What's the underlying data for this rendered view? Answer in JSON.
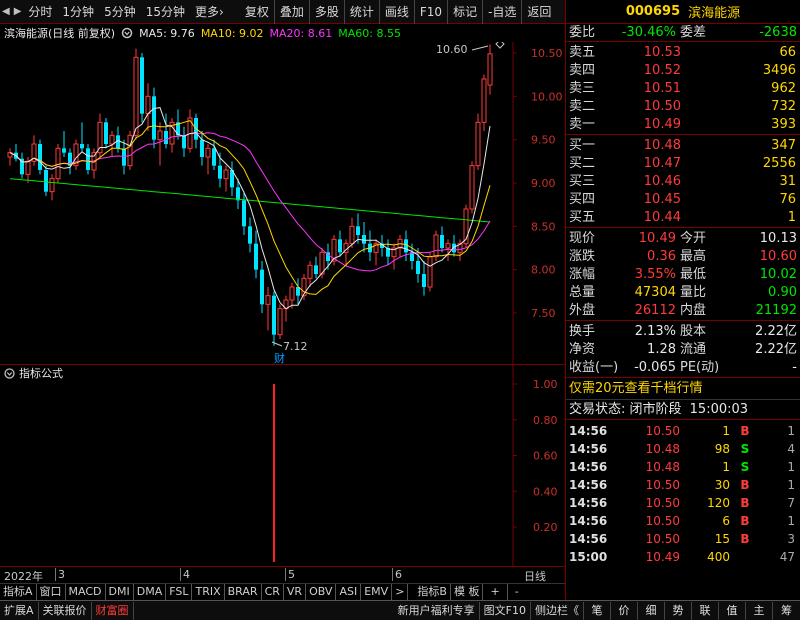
{
  "toolbar": {
    "nav_prev": "◀",
    "nav_next": "▶",
    "timeframes": [
      "分时",
      "1分钟",
      "5分钟",
      "15分钟",
      "更多"
    ],
    "more_arrow": "›",
    "tools": [
      "复权",
      "叠加",
      "多股",
      "统计",
      "画线",
      "F10",
      "标记",
      "-自选",
      "返回"
    ]
  },
  "chart_header": {
    "title": "滨海能源(日线 前复权)",
    "icon": "settings-gear-icon",
    "ma": [
      {
        "label": "MA5: 9.76",
        "color": "#e8e8e8"
      },
      {
        "label": "MA10: 9.02",
        "color": "#ffd700"
      },
      {
        "label": "MA20: 8.61",
        "color": "#ff33ff"
      },
      {
        "label": "MA60: 8.55",
        "color": "#00e600"
      }
    ]
  },
  "price_axis": [
    "10.50",
    "10.00",
    "9.50",
    "9.00",
    "8.50",
    "8.00",
    "7.50"
  ],
  "annotations": {
    "high": "10.60",
    "low": "7.12",
    "finance_mark": "财"
  },
  "indicator": {
    "title": "指标公式",
    "axis": [
      "1.00",
      "0.80",
      "0.60",
      "0.40",
      "0.20"
    ]
  },
  "date_axis": {
    "labels": [
      "2022年",
      "3",
      "4",
      "5",
      "6"
    ],
    "period": "日线"
  },
  "indicator_tabs": {
    "tabs": [
      "指标A",
      "窗口",
      "MACD",
      "DMI",
      "DMA",
      "FSL",
      "TRIX",
      "BRAR",
      "CR",
      "VR",
      "OBV",
      "ASI",
      "EMV"
    ],
    "scroll": ">",
    "right": [
      "指标B",
      "模 板",
      "+",
      "-"
    ]
  },
  "bottom_bar": {
    "left": [
      "扩展A",
      "关联报价",
      "财富圈"
    ],
    "middle": [
      "新用户福利专享",
      "图文F10",
      "侧边栏《"
    ],
    "right_tabs": [
      "笔",
      "价",
      "细",
      "势",
      "联",
      "值",
      "主",
      "筹"
    ]
  },
  "quote": {
    "code": "000695",
    "name": "滨海能源",
    "wei_bi": {
      "label": "委比",
      "value": "-30.46%"
    },
    "wei_cha": {
      "label": "委差",
      "value": "-2638"
    },
    "asks": [
      {
        "label": "卖五",
        "price": "10.53",
        "volume": "66"
      },
      {
        "label": "卖四",
        "price": "10.52",
        "volume": "3496"
      },
      {
        "label": "卖三",
        "price": "10.51",
        "volume": "962"
      },
      {
        "label": "卖二",
        "price": "10.50",
        "volume": "732"
      },
      {
        "label": "卖一",
        "price": "10.49",
        "volume": "393"
      }
    ],
    "bids": [
      {
        "label": "买一",
        "price": "10.48",
        "volume": "347"
      },
      {
        "label": "买二",
        "price": "10.47",
        "volume": "2556"
      },
      {
        "label": "买三",
        "price": "10.46",
        "volume": "31"
      },
      {
        "label": "买四",
        "price": "10.45",
        "volume": "76"
      },
      {
        "label": "买五",
        "price": "10.44",
        "volume": "1"
      }
    ],
    "stats": [
      {
        "l1": "现价",
        "v1": "10.49",
        "c1": "red",
        "l2": "今开",
        "v2": "10.13",
        "c2": "white"
      },
      {
        "l1": "涨跌",
        "v1": "0.36",
        "c1": "red",
        "l2": "最高",
        "v2": "10.60",
        "c2": "red"
      },
      {
        "l1": "涨幅",
        "v1": "3.55%",
        "c1": "red",
        "l2": "最低",
        "v2": "10.02",
        "c2": "green"
      },
      {
        "l1": "总量",
        "v1": "47304",
        "c1": "yellow",
        "l2": "量比",
        "v2": "0.90",
        "c2": "green"
      },
      {
        "l1": "外盘",
        "v1": "26112",
        "c1": "red",
        "l2": "内盘",
        "v2": "21192",
        "c2": "green"
      }
    ],
    "fundamentals": [
      {
        "l1": "换手",
        "v1": "2.13%",
        "l2": "股本",
        "v2": "2.22亿"
      },
      {
        "l1": "净资",
        "v1": "1.28",
        "l2": "流通",
        "v2": "2.22亿"
      },
      {
        "l1": "收益(一)",
        "v1": "-0.065",
        "l2": "PE(动)",
        "v2": "-"
      }
    ],
    "promo": "仅需20元查看千档行情",
    "trade_status": {
      "label": "交易状态: 闭市阶段",
      "time": "15:00:03"
    },
    "ticks": [
      {
        "time": "14:56",
        "price": "10.50",
        "pc": "red",
        "vol": "1",
        "bs": "B",
        "bsc": "red",
        "cnt": "1"
      },
      {
        "time": "14:56",
        "price": "10.48",
        "pc": "red",
        "vol": "98",
        "bs": "S",
        "bsc": "green",
        "cnt": "4"
      },
      {
        "time": "14:56",
        "price": "10.48",
        "pc": "red",
        "vol": "1",
        "bs": "S",
        "bsc": "green",
        "cnt": "1"
      },
      {
        "time": "14:56",
        "price": "10.50",
        "pc": "red",
        "vol": "30",
        "bs": "B",
        "bsc": "red",
        "cnt": "1"
      },
      {
        "time": "14:56",
        "price": "10.50",
        "pc": "red",
        "vol": "120",
        "bs": "B",
        "bsc": "red",
        "cnt": "7"
      },
      {
        "time": "14:56",
        "price": "10.50",
        "pc": "red",
        "vol": "6",
        "bs": "B",
        "bsc": "red",
        "cnt": "1"
      },
      {
        "time": "14:56",
        "price": "10.50",
        "pc": "red",
        "vol": "15",
        "bs": "B",
        "bsc": "red",
        "cnt": "3"
      },
      {
        "time": "15:00",
        "price": "10.49",
        "pc": "red",
        "vol": "400",
        "bs": "",
        "bsc": "red",
        "cnt": "47"
      }
    ]
  },
  "chart_data": {
    "type": "candlestick",
    "title": "滨海能源(日线 前复权)",
    "y_range": [
      7.1,
      10.7
    ],
    "visible_axis_ticks": [
      7.5,
      8.0,
      8.5,
      9.0,
      9.5,
      10.0,
      10.5
    ],
    "annotations": {
      "high": 10.6,
      "low": 7.12
    },
    "candles": [
      [
        9.3,
        9.4,
        9.2,
        9.35
      ],
      [
        9.35,
        9.45,
        9.25,
        9.28
      ],
      [
        9.28,
        9.35,
        9.05,
        9.1
      ],
      [
        9.1,
        9.3,
        9.0,
        9.25
      ],
      [
        9.25,
        9.55,
        9.2,
        9.45
      ],
      [
        9.45,
        9.5,
        9.1,
        9.15
      ],
      [
        9.15,
        9.2,
        8.85,
        8.9
      ],
      [
        8.9,
        9.1,
        8.8,
        9.05
      ],
      [
        9.05,
        9.45,
        9.0,
        9.4
      ],
      [
        9.4,
        9.6,
        9.3,
        9.35
      ],
      [
        9.35,
        9.4,
        9.1,
        9.2
      ],
      [
        9.2,
        9.5,
        9.15,
        9.45
      ],
      [
        9.45,
        9.7,
        9.35,
        9.4
      ],
      [
        9.4,
        9.45,
        9.1,
        9.15
      ],
      [
        9.15,
        9.4,
        9.05,
        9.35
      ],
      [
        9.35,
        9.8,
        9.3,
        9.7
      ],
      [
        9.7,
        9.75,
        9.4,
        9.45
      ],
      [
        9.45,
        9.6,
        9.3,
        9.55
      ],
      [
        9.55,
        9.65,
        9.35,
        9.4
      ],
      [
        9.4,
        9.5,
        9.1,
        9.2
      ],
      [
        9.2,
        9.6,
        9.15,
        9.55
      ],
      [
        9.55,
        10.55,
        9.5,
        10.45
      ],
      [
        10.45,
        10.5,
        9.7,
        9.8
      ],
      [
        9.8,
        10.15,
        9.6,
        10.0
      ],
      [
        10.0,
        10.1,
        9.4,
        9.5
      ],
      [
        9.5,
        9.7,
        9.2,
        9.6
      ],
      [
        9.6,
        9.8,
        9.4,
        9.45
      ],
      [
        9.45,
        9.75,
        9.35,
        9.7
      ],
      [
        9.7,
        9.85,
        9.5,
        9.55
      ],
      [
        9.55,
        9.65,
        9.3,
        9.4
      ],
      [
        9.4,
        9.85,
        9.35,
        9.75
      ],
      [
        9.75,
        9.8,
        9.4,
        9.5
      ],
      [
        9.5,
        9.6,
        9.2,
        9.3
      ],
      [
        9.3,
        9.45,
        9.1,
        9.4
      ],
      [
        9.4,
        9.5,
        9.15,
        9.2
      ],
      [
        9.2,
        9.35,
        8.95,
        9.05
      ],
      [
        9.05,
        9.2,
        8.9,
        9.15
      ],
      [
        9.15,
        9.25,
        8.85,
        8.95
      ],
      [
        8.95,
        9.05,
        8.7,
        8.8
      ],
      [
        8.8,
        8.9,
        8.4,
        8.5
      ],
      [
        8.5,
        8.6,
        8.2,
        8.3
      ],
      [
        8.3,
        8.45,
        7.9,
        8.0
      ],
      [
        8.0,
        8.1,
        7.5,
        7.6
      ],
      [
        7.6,
        7.8,
        7.3,
        7.7
      ],
      [
        7.7,
        7.75,
        7.12,
        7.25
      ],
      [
        7.25,
        7.6,
        7.2,
        7.55
      ],
      [
        7.55,
        7.7,
        7.4,
        7.65
      ],
      [
        7.65,
        7.85,
        7.55,
        7.8
      ],
      [
        7.8,
        7.9,
        7.6,
        7.7
      ],
      [
        7.7,
        7.95,
        7.65,
        7.9
      ],
      [
        7.9,
        8.1,
        7.8,
        8.05
      ],
      [
        8.05,
        8.15,
        7.9,
        7.95
      ],
      [
        7.95,
        8.25,
        7.9,
        8.2
      ],
      [
        8.2,
        8.3,
        8.0,
        8.1
      ],
      [
        8.1,
        8.4,
        8.05,
        8.35
      ],
      [
        8.35,
        8.45,
        8.15,
        8.2
      ],
      [
        8.2,
        8.35,
        8.05,
        8.3
      ],
      [
        8.3,
        8.6,
        8.25,
        8.5
      ],
      [
        8.5,
        8.65,
        8.3,
        8.4
      ],
      [
        8.4,
        8.55,
        8.2,
        8.3
      ],
      [
        8.3,
        8.45,
        8.1,
        8.2
      ],
      [
        8.2,
        8.35,
        8.05,
        8.3
      ],
      [
        8.3,
        8.4,
        8.15,
        8.25
      ],
      [
        8.25,
        8.35,
        8.05,
        8.15
      ],
      [
        8.15,
        8.3,
        8.0,
        8.25
      ],
      [
        8.25,
        8.4,
        8.15,
        8.35
      ],
      [
        8.35,
        8.45,
        8.1,
        8.2
      ],
      [
        8.2,
        8.3,
        8.0,
        8.1
      ],
      [
        8.1,
        8.25,
        7.85,
        7.95
      ],
      [
        7.95,
        8.1,
        7.7,
        7.8
      ],
      [
        7.8,
        8.2,
        7.75,
        8.15
      ],
      [
        8.15,
        8.45,
        8.1,
        8.4
      ],
      [
        8.4,
        8.5,
        8.2,
        8.25
      ],
      [
        8.25,
        8.35,
        8.1,
        8.3
      ],
      [
        8.3,
        8.4,
        8.15,
        8.2
      ],
      [
        8.2,
        8.35,
        8.1,
        8.3
      ],
      [
        8.3,
        8.75,
        8.25,
        8.7
      ],
      [
        8.7,
        9.25,
        8.65,
        9.2
      ],
      [
        9.2,
        9.8,
        9.15,
        9.7
      ],
      [
        9.7,
        10.25,
        9.6,
        10.2
      ],
      [
        10.13,
        10.6,
        10.02,
        10.49
      ]
    ],
    "ma": {
      "MA5": 9.76,
      "MA10": 9.02,
      "MA20": 8.61,
      "MA60": 8.55
    },
    "indicator_bar": {
      "index": 44,
      "value": 1.0,
      "axis": [
        0,
        1.0
      ]
    }
  }
}
